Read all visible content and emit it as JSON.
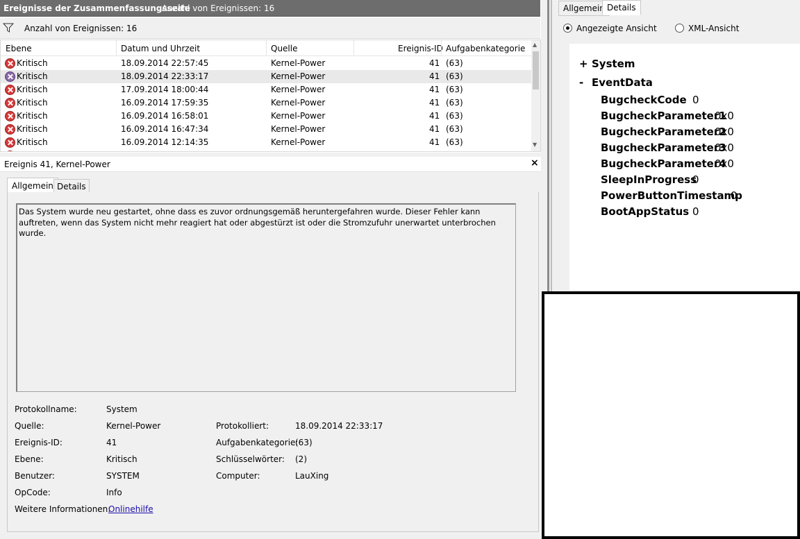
{
  "header": {
    "title": "Ereignisse der Zusammenfassungsseite",
    "count_text": "Anzahl von Ereignissen: 16"
  },
  "filter": {
    "label": "Anzahl von Ereignissen: 16"
  },
  "table": {
    "columns": [
      "Ebene",
      "Datum und Uhrzeit",
      "Quelle",
      "Ereignis-ID",
      "Aufgabenkategorie"
    ],
    "rows": [
      {
        "level": "Kritisch",
        "datetime": "18.09.2014 22:57:45",
        "source": "Kernel-Power",
        "id": "41",
        "category": "(63)"
      },
      {
        "level": "Kritisch",
        "datetime": "18.09.2014 22:33:17",
        "source": "Kernel-Power",
        "id": "41",
        "category": "(63)"
      },
      {
        "level": "Kritisch",
        "datetime": "17.09.2014 18:00:44",
        "source": "Kernel-Power",
        "id": "41",
        "category": "(63)"
      },
      {
        "level": "Kritisch",
        "datetime": "16.09.2014 17:59:35",
        "source": "Kernel-Power",
        "id": "41",
        "category": "(63)"
      },
      {
        "level": "Kritisch",
        "datetime": "16.09.2014 16:58:01",
        "source": "Kernel-Power",
        "id": "41",
        "category": "(63)"
      },
      {
        "level": "Kritisch",
        "datetime": "16.09.2014 16:47:34",
        "source": "Kernel-Power",
        "id": "41",
        "category": "(63)"
      },
      {
        "level": "Kritisch",
        "datetime": "16.09.2014 12:14:35",
        "source": "Kernel-Power",
        "id": "41",
        "category": "(63)"
      }
    ]
  },
  "detail": {
    "title": "Ereignis 41, Kernel-Power",
    "close": "×",
    "tabs": [
      "Allgemein",
      "Details"
    ],
    "message": "Das System wurde neu gestartet, ohne dass es zuvor ordnungsgemäß heruntergefahren wurde. Dieser Fehler kann auftreten, wenn das System nicht mehr reagiert hat oder abgestürzt ist oder die Stromzufuhr unerwartet unterbrochen wurde.",
    "fields": {
      "protokollname_label": "Protokollname:",
      "protokollname": "System",
      "quelle_label": "Quelle:",
      "quelle": "Kernel-Power",
      "protokolliert_label": "Protokolliert:",
      "protokolliert": "18.09.2014 22:33:17",
      "ereignisid_label": "Ereignis-ID:",
      "ereignisid": "41",
      "aufgabenkategorie_label": "Aufgabenkategorie:",
      "aufgabenkategorie": "(63)",
      "ebene_label": "Ebene:",
      "ebene": "Kritisch",
      "schluesselwoerter_label": "Schlüsselwörter:",
      "schluesselwoerter": "(2)",
      "benutzer_label": "Benutzer:",
      "benutzer": "SYSTEM",
      "computer_label": "Computer:",
      "computer": "LauXing",
      "opcode_label": "OpCode:",
      "opcode": "Info",
      "weitere_label": "Weitere Informationen:",
      "weitere_link": "Onlinehilfe"
    }
  },
  "right": {
    "tabs": [
      "Allgemein",
      "Details"
    ],
    "radio_view": "Angezeigte Ansicht",
    "radio_xml": "XML-Ansicht",
    "tree": {
      "system_toggle": "+",
      "system": "System",
      "eventdata_toggle": "-",
      "eventdata": "EventData",
      "items": [
        {
          "name": "BugcheckCode",
          "value": "0"
        },
        {
          "name": "BugcheckParameter1",
          "value": "0x0"
        },
        {
          "name": "BugcheckParameter2",
          "value": "0x0"
        },
        {
          "name": "BugcheckParameter3",
          "value": "0x0"
        },
        {
          "name": "BugcheckParameter4",
          "value": "0x0"
        },
        {
          "name": "SleepInProgress",
          "value": "0"
        },
        {
          "name": "PowerButtonTimestamp",
          "value": "0"
        },
        {
          "name": "BootAppStatus",
          "value": "0"
        }
      ]
    }
  }
}
